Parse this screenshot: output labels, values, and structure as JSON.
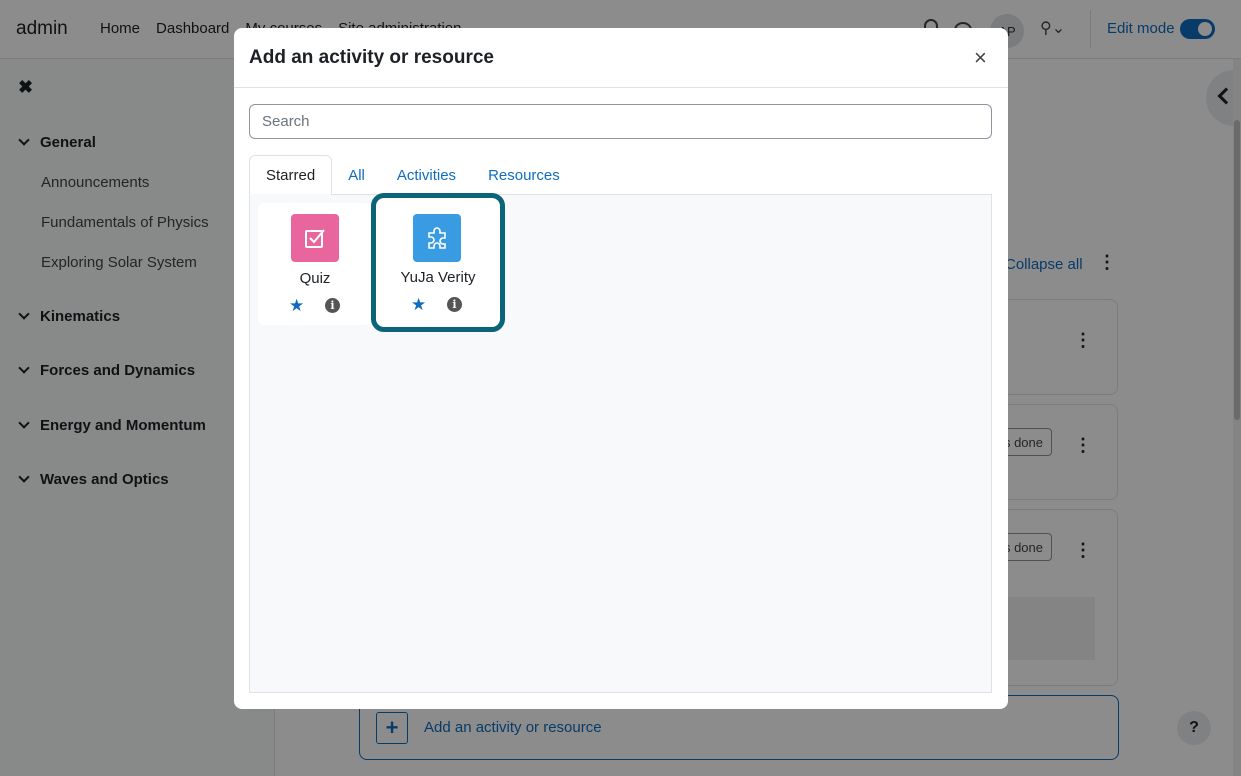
{
  "navbar": {
    "brand": "admin",
    "links": [
      "Home",
      "Dashboard",
      "My courses",
      "Site administration"
    ],
    "avatar_initials": "AP",
    "edit_mode_label": "Edit mode",
    "edit_mode_on": true
  },
  "drawer": {
    "close_glyph": "✖",
    "sections": [
      {
        "label": "General",
        "items": [
          "Announcements",
          "Fundamentals of Physics",
          "Exploring Solar System"
        ]
      },
      {
        "label": "Kinematics"
      },
      {
        "label": "Forces and Dynamics"
      },
      {
        "label": "Energy and Momentum"
      },
      {
        "label": "Waves and Optics"
      }
    ]
  },
  "main": {
    "collapse_all": "Collapse all",
    "done_button_1": "s done",
    "done_button_2": "s done",
    "add_activity": "Add an activity or resource",
    "help_glyph": "?"
  },
  "modal": {
    "title": "Add an activity or resource",
    "close_glyph": "×",
    "search_placeholder": "Search",
    "tabs": [
      "Starred",
      "All",
      "Activities",
      "Resources"
    ],
    "active_tab": "Starred",
    "items": [
      {
        "label": "Quiz",
        "icon": "quiz-icon",
        "color": "#e8659e",
        "starred": true
      },
      {
        "label": "YuJa Verity",
        "icon": "puzzle-icon",
        "color": "#399be2",
        "starred": true
      }
    ]
  },
  "colors": {
    "primary": "#0f6cbf",
    "focus_ring": "#0b6479",
    "quiz": "#e8659e",
    "plugin": "#399be2"
  }
}
